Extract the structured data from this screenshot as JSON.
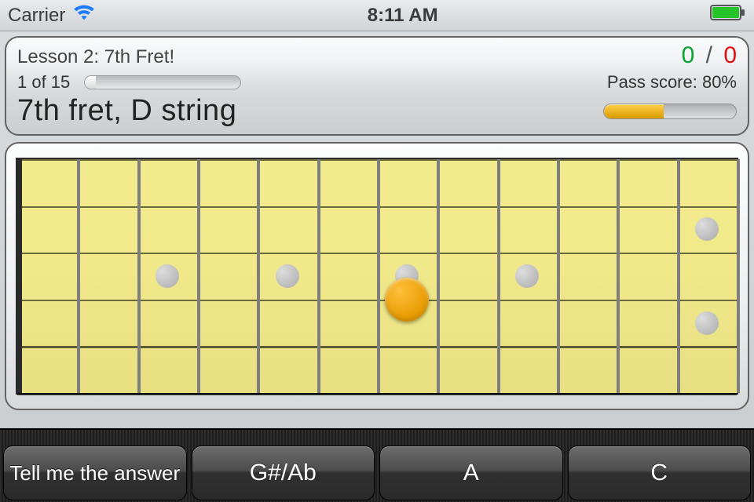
{
  "status": {
    "carrier": "Carrier",
    "time": "8:11 AM"
  },
  "header": {
    "lesson_title": "Lesson 2: 7th Fret!",
    "question_index": "1 of 15",
    "pass_score_label": "Pass score: 80%",
    "prompt": "7th fret, D string",
    "score_correct": "0",
    "score_slash": "/",
    "score_wrong": "0"
  },
  "pass_bar": {
    "fill_pct": 45
  },
  "fretboard": {
    "num_strings": 6,
    "num_frets": 12,
    "inlays": [
      {
        "fret": 3,
        "string_between": 3.5
      },
      {
        "fret": 5,
        "string_between": 3.5
      },
      {
        "fret": 7,
        "string_between": 3.5
      },
      {
        "fret": 9,
        "string_between": 3.5
      },
      {
        "fret": 12,
        "string_between": 2.5
      },
      {
        "fret": 12,
        "string_between": 4.5
      }
    ],
    "note": {
      "fret": 7,
      "string": 4
    }
  },
  "buttons": {
    "hint": "Tell me the answer",
    "opt1": "G#/Ab",
    "opt2": "A",
    "opt3": "C"
  }
}
